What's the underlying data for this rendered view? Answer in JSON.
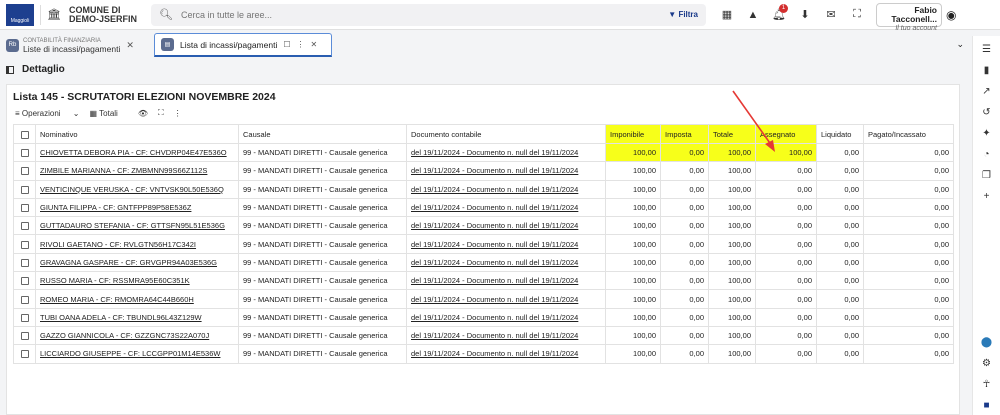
{
  "header": {
    "entity_line1": "COMUNE DI",
    "entity_line2": "DEMO-JSERFIN",
    "search_placeholder": "Cerca in tutte le aree...",
    "filter_label": "Filtra",
    "notification_count": "1",
    "user_name": "Fabio Tacconell...",
    "user_subtitle": "Il tuo account"
  },
  "tabs": [
    {
      "small": "CONTABILITÀ FINANZIARIA",
      "label": "Liste di incassi/pagamenti",
      "icon": "Rb"
    },
    {
      "label": "Lista di incassi/pagamenti"
    }
  ],
  "section_title": "Dettaglio",
  "card": {
    "title": "Lista 145 - SCRUTATORI ELEZIONI NOVEMBRE 2024",
    "toolbar": {
      "operations": "Operazioni",
      "totals": "Totali"
    }
  },
  "table": {
    "columns": [
      "Nominativo",
      "Causale",
      "Documento contabile",
      "Imponibile",
      "Imposta",
      "Totale",
      "Assegnato",
      "Liquidato",
      "Pagato/Incassato"
    ],
    "rows": [
      [
        "CHIOVETTA DEBORA PIA - CF: CHVDRP04E47E536O",
        "99 - MANDATI DIRETTI - Causale generica",
        "del 19/11/2024 - Documento n. null del 19/11/2024",
        "100,00",
        "0,00",
        "100,00",
        "100,00",
        "0,00",
        "0,00"
      ],
      [
        "ZIMBILE MARIANNA - CF: ZMBMNN99S66Z112S",
        "99 - MANDATI DIRETTI - Causale generica",
        "del 19/11/2024 - Documento n. null del 19/11/2024",
        "100,00",
        "0,00",
        "100,00",
        "0,00",
        "0,00",
        "0,00"
      ],
      [
        "VENTICINQUE VERUSKA - CF: VNTVSK90L50E536Q",
        "99 - MANDATI DIRETTI - Causale generica",
        "del 19/11/2024 - Documento n. null del 19/11/2024",
        "100,00",
        "0,00",
        "100,00",
        "0,00",
        "0,00",
        "0,00"
      ],
      [
        "GIUNTA FILIPPA - CF: GNTFPP89P58E536Z",
        "99 - MANDATI DIRETTI - Causale generica",
        "del 19/11/2024 - Documento n. null del 19/11/2024",
        "100,00",
        "0,00",
        "100,00",
        "0,00",
        "0,00",
        "0,00"
      ],
      [
        "GUTTADAURO STEFANIA - CF: GTTSFN95L51E536G",
        "99 - MANDATI DIRETTI - Causale generica",
        "del 19/11/2024 - Documento n. null del 19/11/2024",
        "100,00",
        "0,00",
        "100,00",
        "0,00",
        "0,00",
        "0,00"
      ],
      [
        "RIVOLI GAETANO - CF: RVLGTN56H17C342I",
        "99 - MANDATI DIRETTI - Causale generica",
        "del 19/11/2024 - Documento n. null del 19/11/2024",
        "100,00",
        "0,00",
        "100,00",
        "0,00",
        "0,00",
        "0,00"
      ],
      [
        "GRAVAGNA GASPARE - CF: GRVGPR94A03E536G",
        "99 - MANDATI DIRETTI - Causale generica",
        "del 19/11/2024 - Documento n. null del 19/11/2024",
        "100,00",
        "0,00",
        "100,00",
        "0,00",
        "0,00",
        "0,00"
      ],
      [
        "RUSSO MARIA - CF: RSSMRA95E60C351K",
        "99 - MANDATI DIRETTI - Causale generica",
        "del 19/11/2024 - Documento n. null del 19/11/2024",
        "100,00",
        "0,00",
        "100,00",
        "0,00",
        "0,00",
        "0,00"
      ],
      [
        "ROMEO MARIA - CF: RMOMRA64C44B660H",
        "99 - MANDATI DIRETTI - Causale generica",
        "del 19/11/2024 - Documento n. null del 19/11/2024",
        "100,00",
        "0,00",
        "100,00",
        "0,00",
        "0,00",
        "0,00"
      ],
      [
        "TUBI OANA ADELA - CF: TBUNDL96L43Z129W",
        "99 - MANDATI DIRETTI - Causale generica",
        "del 19/11/2024 - Documento n. null del 19/11/2024",
        "100,00",
        "0,00",
        "100,00",
        "0,00",
        "0,00",
        "0,00"
      ],
      [
        "GAZZO GIANNICOLA - CF: GZZGNC73S22A070J",
        "99 - MANDATI DIRETTI - Causale generica",
        "del 19/11/2024 - Documento n. null del 19/11/2024",
        "100,00",
        "0,00",
        "100,00",
        "0,00",
        "0,00",
        "0,00"
      ],
      [
        "LICCIARDO GIUSEPPE - CF: LCCGPP01M14E536W",
        "99 - MANDATI DIRETTI - Causale generica",
        "del 19/11/2024 - Documento n. null del 19/11/2024",
        "100,00",
        "0,00",
        "100,00",
        "0,00",
        "0,00",
        "0,00"
      ]
    ]
  },
  "colors": {
    "highlight": "#f7ff1a",
    "annotation_arrow": "#e53935",
    "brand": "#1d3f8f"
  }
}
